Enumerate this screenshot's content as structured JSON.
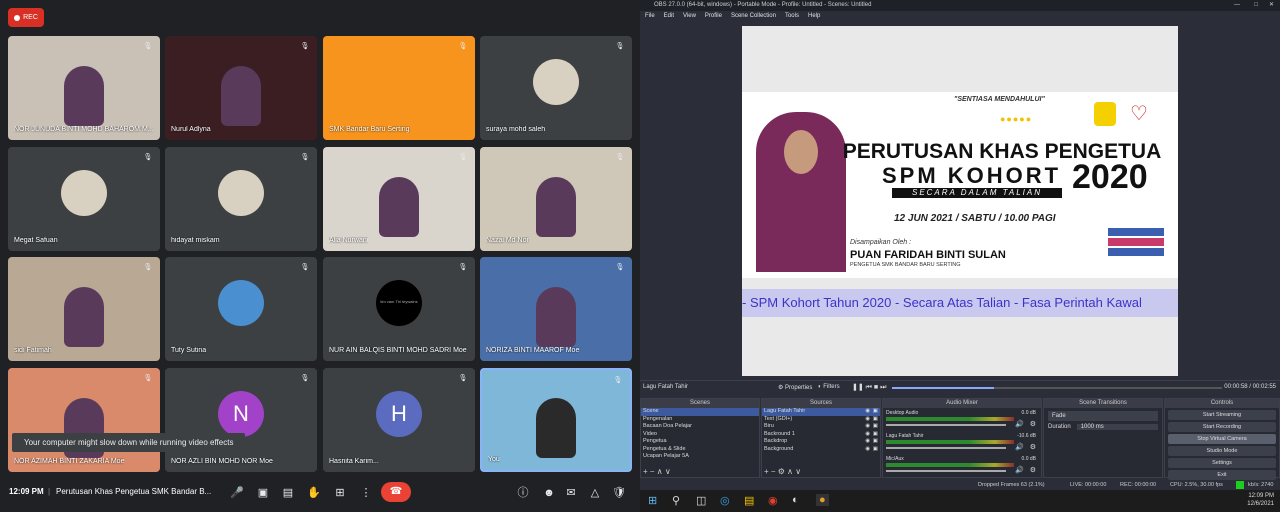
{
  "meet": {
    "rec_label": "REC",
    "participants": [
      {
        "name": "NOR JUNUDA BINTI MOHD BAHAROM M...",
        "bg": "#c9c1b6"
      },
      {
        "name": "Nurul Adlyna",
        "bg": "#3a1e22"
      },
      {
        "name": "SMK Bandar Baru Serting",
        "bg": "#f7941d"
      },
      {
        "name": "suraya mohd saleh",
        "bg": "#3c4043"
      },
      {
        "name": "Megat Safuan",
        "bg": "#3c4043"
      },
      {
        "name": "hidayat miskam",
        "bg": "#3c4043"
      },
      {
        "name": "Alia Nurwani",
        "bg": "#d9d4cc"
      },
      {
        "name": "Nazai Md Nor",
        "bg": "#cfc7b8"
      },
      {
        "name": "sidi Fatimah",
        "bg": "#b9a894"
      },
      {
        "name": "Tuty Sutina",
        "bg": "#3c4043"
      },
      {
        "name": "NUR AIN BALQIS BINTI MOHD SADRI Moe",
        "bg": "#3c4043"
      },
      {
        "name": "NORIZA BINTI MAAROF Moe",
        "bg": "#4a6fa8"
      },
      {
        "name": "NOR AZIMAH BINTI ZAKARIA Moe",
        "bg": "#d98a6a"
      },
      {
        "name": "NOR AZLI BIN MOHD NOR Moe",
        "bg": "#3c4043",
        "letter": "N",
        "letter_color": "#a142c8"
      },
      {
        "name": "Hasnita Karim...",
        "bg": "#3c4043",
        "letter": "H",
        "letter_color": "#5b6bc0"
      },
      {
        "name": "You",
        "bg": "#7fb7d8"
      }
    ],
    "balqis_avatar_text": "tim vam Thi teywalns",
    "toast": "Your computer might slow down while running video effects",
    "time": "12:09 PM",
    "meeting_title": "Perutusan Khas Pengetua SMK Bandar B..."
  },
  "obs": {
    "title": "OBS 27.0.0 (64-bit, windows) - Portable Mode - Profile: Untitled - Scenes: Untitled",
    "menu": [
      "File",
      "Edit",
      "View",
      "Profile",
      "Scene Collection",
      "Tools",
      "Help"
    ],
    "slide": {
      "motto": "\"SENTIASA MENDAHULUI\"",
      "heading1": "PERUTUSAN KHAS PENGETUA",
      "heading2": "SPM KOHORT",
      "year": "2020",
      "subheading": "SECARA DALAM TALIAN",
      "date": "12 JUN 2021 / SABTU / 10.00 PAGI",
      "presented_by": "Disampaikan Oleh :",
      "presenter": "PUAN FARIDAH BINTI SULAN",
      "presenter_role": "PENGETUA SMK BANDAR BARU SERTING",
      "ticker": "- SPM Kohort Tahun 2020 - Secara Atas Talian - Fasa Perintah Kawal"
    },
    "source_bar": {
      "name": "Lagu Fatah Tahir",
      "properties": "Properties",
      "filters": "Filters",
      "time": "00:00:58 / 00:02:55"
    },
    "scenes_title": "Scenes",
    "scenes": [
      "Scene",
      "Pengenalan",
      "Bacaan Doa Pelajar",
      "Video",
      "Pengetua",
      "Pengetua & Slide",
      "Ucapan Pelajar 5A"
    ],
    "sources_title": "Sources",
    "sources": [
      "Lagu Fatah Tahir",
      "Text (GDI+)",
      "Biru",
      "Backround 1",
      "Backdrop",
      "Background"
    ],
    "mixer_title": "Audio Mixer",
    "mixer": [
      {
        "name": "Desktop Audio",
        "db": "0.0 dB"
      },
      {
        "name": "Lagu Fatah Tahir",
        "db": "-10.6 dB"
      },
      {
        "name": "Mic/Aux",
        "db": "0.0 dB"
      }
    ],
    "transitions_title": "Scene Transitions",
    "transition": "Fade",
    "duration_label": "Duration",
    "duration": "1000 ms",
    "controls_title": "Controls",
    "controls": [
      "Start Streaming",
      "Start Recording",
      "Stop Virtual Camera",
      "Studio Mode",
      "Settings",
      "Exit"
    ],
    "status": {
      "dropped": "Dropped Frames 63 (2.1%)",
      "live": "LIVE: 00:00:00",
      "rec": "REC: 00:00:00",
      "cpu": "CPU: 2.5%, 30.00 fps",
      "kbps": "kb/s: 2740"
    },
    "clock_time": "12:09 PM",
    "clock_date": "12/6/2021"
  }
}
